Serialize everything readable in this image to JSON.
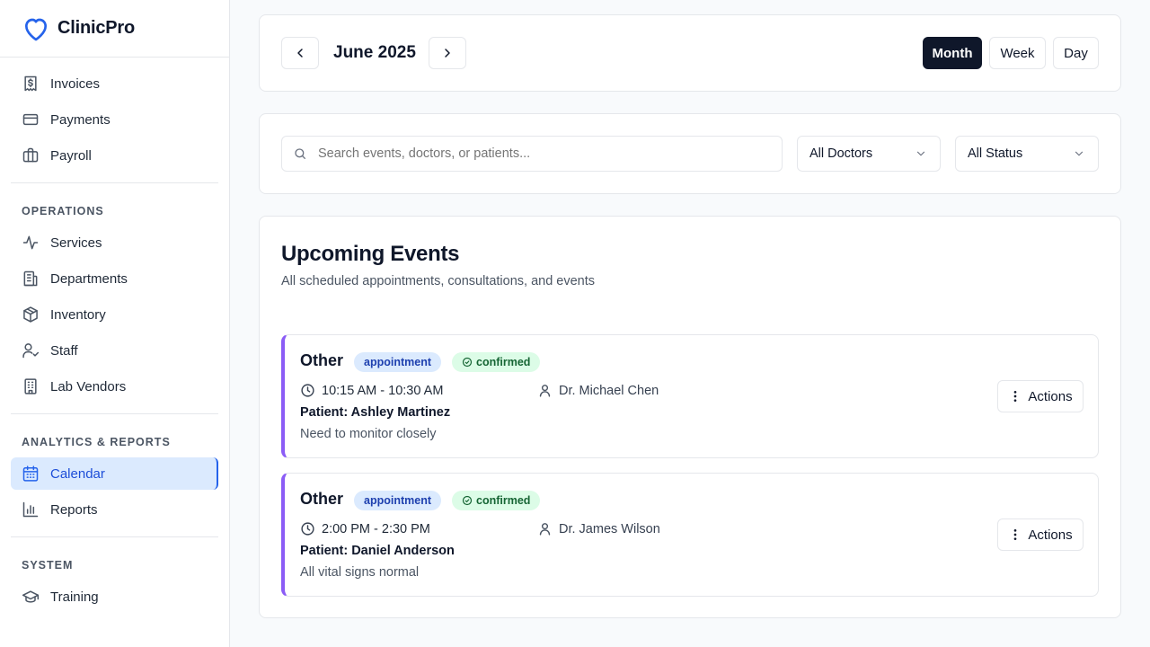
{
  "brand": {
    "name": "ClinicPro",
    "accent": "#2563eb"
  },
  "sidebar": {
    "top_items": [
      {
        "label": "Invoices",
        "icon": "receipt-dollar-icon"
      },
      {
        "label": "Payments",
        "icon": "credit-card-icon"
      },
      {
        "label": "Payroll",
        "icon": "briefcase-icon"
      }
    ],
    "sections": [
      {
        "title": "OPERATIONS",
        "items": [
          {
            "label": "Services",
            "icon": "activity-icon"
          },
          {
            "label": "Departments",
            "icon": "building-icon"
          },
          {
            "label": "Inventory",
            "icon": "package-icon"
          },
          {
            "label": "Staff",
            "icon": "user-check-icon"
          },
          {
            "label": "Lab Vendors",
            "icon": "office-building-icon"
          }
        ]
      },
      {
        "title": "ANALYTICS & REPORTS",
        "items": [
          {
            "label": "Calendar",
            "icon": "calendar-icon",
            "active": true
          },
          {
            "label": "Reports",
            "icon": "bar-chart-icon"
          }
        ]
      },
      {
        "title": "SYSTEM",
        "items": [
          {
            "label": "Training",
            "icon": "graduation-cap-icon"
          }
        ]
      }
    ]
  },
  "header": {
    "month_label": "June 2025",
    "views": [
      "Month",
      "Week",
      "Day"
    ],
    "active_view": "Month"
  },
  "filters": {
    "search_placeholder": "Search events, doctors, or patients...",
    "doctor_select": "All Doctors",
    "status_select": "All Status"
  },
  "events_panel": {
    "title": "Upcoming Events",
    "subtitle": "All scheduled appointments, consultations, and events",
    "actions_label": "Actions",
    "patient_prefix": "Patient: ",
    "events": [
      {
        "title": "Other",
        "type_badge": "appointment",
        "status_badge": "confirmed",
        "time": "10:15 AM - 10:30 AM",
        "doctor": "Dr. Michael Chen",
        "patient": "Ashley Martinez",
        "note": "Need to monitor closely"
      },
      {
        "title": "Other",
        "type_badge": "appointment",
        "status_badge": "confirmed",
        "time": "2:00 PM - 2:30 PM",
        "doctor": "Dr. James Wilson",
        "patient": "Daniel Anderson",
        "note": "All vital signs normal"
      }
    ]
  },
  "colors": {
    "event_accent": "#8b5cf6",
    "badge_blue": "#dbeafe",
    "badge_green": "#dcfce7",
    "active_nav": "#dbeafe",
    "dark_button": "#0f172a"
  }
}
